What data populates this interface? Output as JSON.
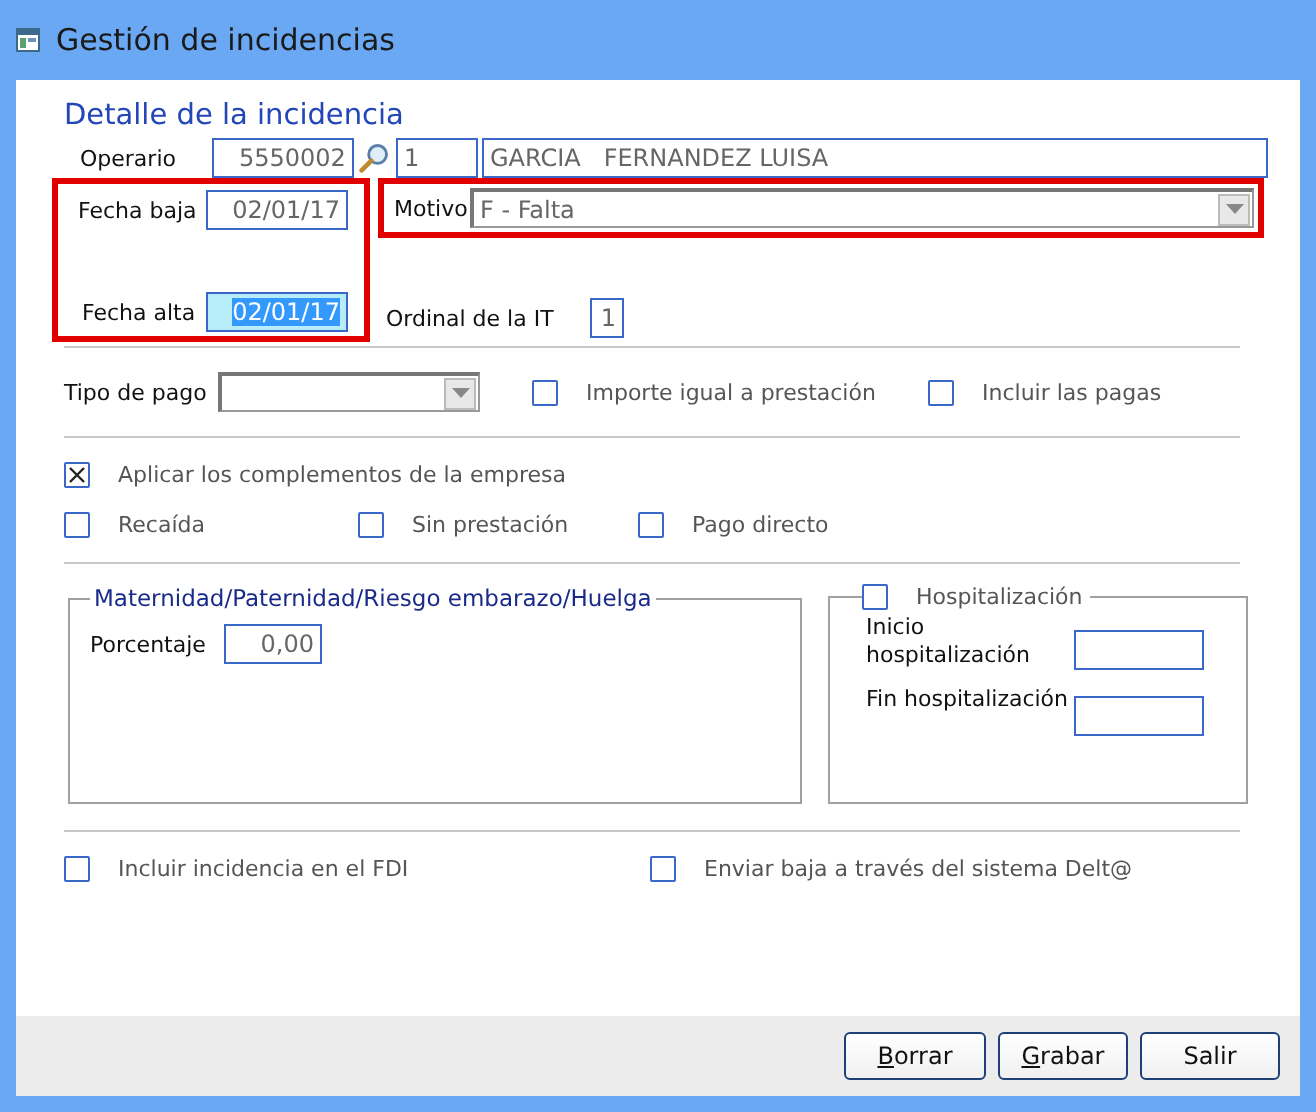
{
  "window": {
    "title": "Gestión de incidencias"
  },
  "section_title": "Detalle de la incidencia",
  "operario": {
    "label": "Operario",
    "code": "5550002",
    "number": "1",
    "name": "GARCIA   FERNANDEZ LUISA"
  },
  "fechas": {
    "highlighted": true,
    "baja": {
      "label": "Fecha baja",
      "value": "02/01/17"
    },
    "alta": {
      "label": "Fecha alta",
      "value": "02/01/17",
      "focused": true
    }
  },
  "motivo": {
    "label": "Motivo",
    "value": "F - Falta",
    "highlighted": true
  },
  "ordinal": {
    "label": "Ordinal de la IT",
    "value": "1"
  },
  "tipo_pago": {
    "label": "Tipo de pago"
  },
  "pago_options": [
    {
      "label": "Importe igual a prestación",
      "checked": false
    },
    {
      "label": "Incluir las pagas",
      "checked": false
    }
  ],
  "aplicar": {
    "label": "Aplicar los complementos de la empresa",
    "checked": true
  },
  "extra_options": [
    {
      "label": "Recaída",
      "checked": false
    },
    {
      "label": "Sin prestación",
      "checked": false
    },
    {
      "label": "Pago directo",
      "checked": false
    }
  ],
  "maternidad": {
    "title": "Maternidad/Paternidad/Riesgo embarazo/Huelga",
    "porcentaje_label": "Porcentaje",
    "porcentaje": "0,00"
  },
  "hospitalizacion": {
    "label": "Hospitalización",
    "checked": false,
    "inicio_label": "Inicio hospitalización",
    "fin_label": "Fin hospitalización"
  },
  "bottom_options": [
    {
      "label": "Incluir incidencia en el FDI",
      "checked": false
    },
    {
      "label": "Enviar baja a través del sistema Delt@",
      "checked": false
    }
  ],
  "buttons": [
    {
      "label": "Borrar",
      "underline_first": true
    },
    {
      "label": "Grabar",
      "underline_first": true
    },
    {
      "label": "Salir",
      "underline_first": false
    }
  ]
}
